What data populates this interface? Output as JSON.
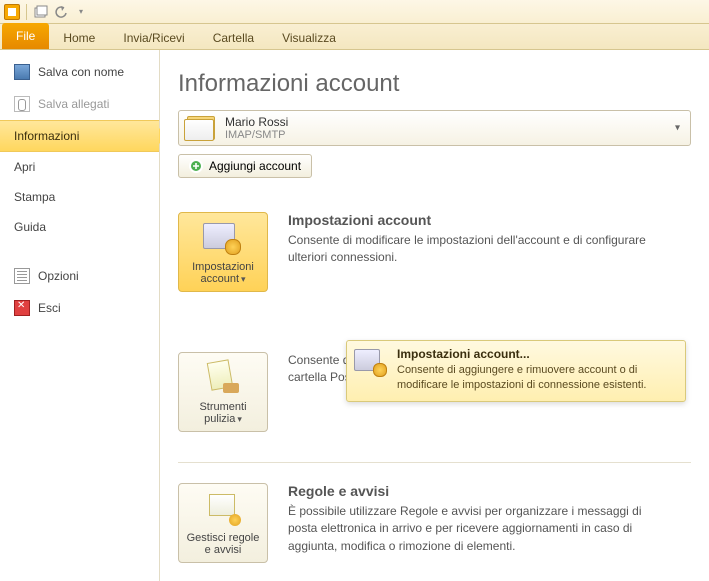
{
  "titlebar": {
    "app_icon": "outlook-icon"
  },
  "ribbon": {
    "file": "File",
    "tabs": [
      "Home",
      "Invia/Ricevi",
      "Cartella",
      "Visualizza"
    ]
  },
  "sidebar": {
    "save_as": "Salva con nome",
    "save_attach": "Salva allegati",
    "info": "Informazioni",
    "open": "Apri",
    "print": "Stampa",
    "help": "Guida",
    "options": "Opzioni",
    "exit": "Esci"
  },
  "content": {
    "title": "Informazioni account",
    "account": {
      "name": "Mario Rossi",
      "protocol": "IMAP/SMTP"
    },
    "add_account": "Aggiungi account",
    "sections": {
      "settings": {
        "button": "Impostazioni account",
        "heading": "Impostazioni account",
        "desc": "Consente di modificare le impostazioni dell'account e di configurare ulteriori connessioni."
      },
      "cleanup": {
        "button": "Strumenti pulizia",
        "desc": "Consente di gestire la dimensione della cassetta postale svuotando la cartella Posta eliminata e archiviando elementi."
      },
      "rules": {
        "button": "Gestisci regole e avvisi",
        "heading": "Regole e avvisi",
        "desc": "È possibile utilizzare Regole e avvisi per organizzare i messaggi di posta elettronica in arrivo e per ricevere aggiornamenti in caso di aggiunta, modifica o rimozione di elementi."
      }
    },
    "dropdown": {
      "title": "Impostazioni account...",
      "desc": "Consente di aggiungere e rimuovere account o di modificare le impostazioni di connessione esistenti."
    }
  }
}
